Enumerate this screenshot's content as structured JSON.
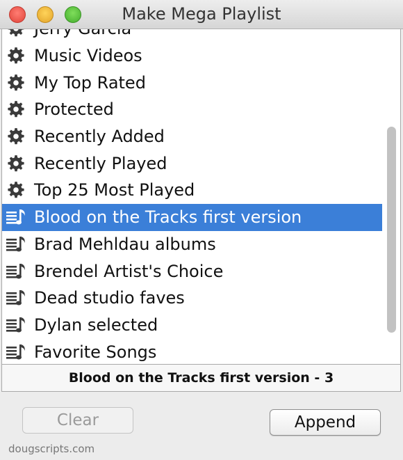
{
  "window": {
    "title": "Make Mega Playlist"
  },
  "list": {
    "items": [
      {
        "label": "Jerry Garcia",
        "icon": "gear-icon"
      },
      {
        "label": "Music Videos",
        "icon": "gear-icon"
      },
      {
        "label": "My Top Rated",
        "icon": "gear-icon"
      },
      {
        "label": "Protected",
        "icon": "gear-icon"
      },
      {
        "label": "Recently Added",
        "icon": "gear-icon"
      },
      {
        "label": "Recently Played",
        "icon": "gear-icon"
      },
      {
        "label": "Top 25 Most Played",
        "icon": "gear-icon"
      },
      {
        "label": "Blood on the Tracks first version",
        "icon": "playlist-icon",
        "selected": true
      },
      {
        "label": "Brad Mehldau albums",
        "icon": "playlist-icon"
      },
      {
        "label": "Brendel Artist's Choice",
        "icon": "playlist-icon"
      },
      {
        "label": "Dead studio faves",
        "icon": "playlist-icon"
      },
      {
        "label": "Dylan selected",
        "icon": "playlist-icon"
      },
      {
        "label": "Favorite Songs",
        "icon": "playlist-icon"
      }
    ]
  },
  "status": {
    "text": "Blood on the Tracks first version - 3"
  },
  "buttons": {
    "clear_label": "Clear",
    "append_label": "Append"
  },
  "footer": {
    "credit": "dougscripts.com"
  },
  "colors": {
    "selection": "#3b7fd8"
  }
}
